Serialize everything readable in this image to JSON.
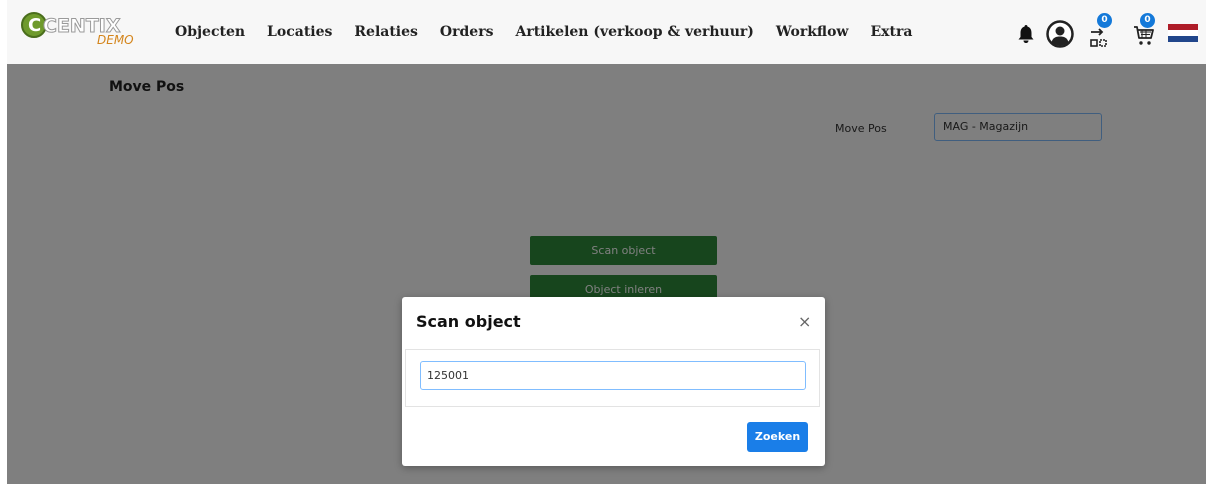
{
  "logo": {
    "brand": "CENTIX",
    "sub": "DEMO"
  },
  "nav": {
    "items": [
      "Objecten",
      "Locaties",
      "Relaties",
      "Orders",
      "Artikelen (verkoop & verhuur)",
      "Workflow",
      "Extra"
    ]
  },
  "icons": {
    "notifications": "bell-icon",
    "account": "user-circle-icon",
    "transfer": "transfer-cart-icon",
    "cart": "shopping-cart-icon",
    "language": "dutch-flag-icon"
  },
  "badges": {
    "transfer_count": "0",
    "cart_count": "0"
  },
  "page": {
    "title": "Move Pos",
    "location_label": "Move Pos",
    "location_value": "MAG - Magazijn",
    "scan_button": "Scan object",
    "inleren_button": "Object inleren"
  },
  "modal": {
    "title": "Scan object",
    "close": "×",
    "input_value": "125001",
    "submit": "Zoeken"
  },
  "colors": {
    "primary": "#1a7ee8",
    "success": "#2e8b3a",
    "badge": "#1479d9",
    "flag_red": "#ae1c28",
    "flag_blue": "#21468b"
  }
}
